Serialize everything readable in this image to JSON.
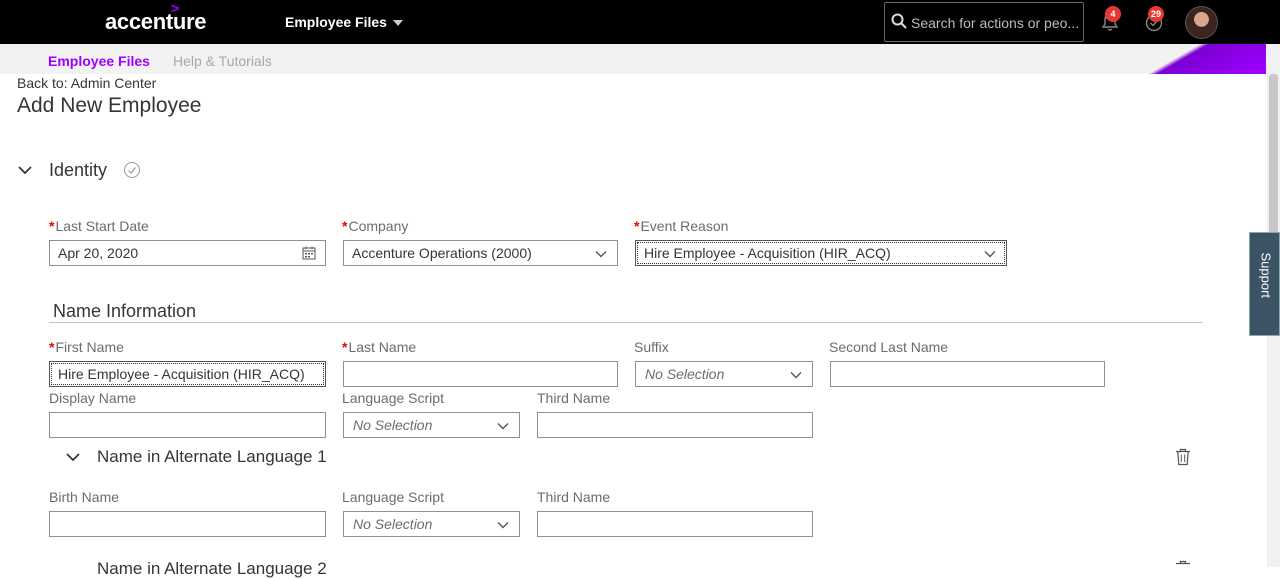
{
  "header": {
    "logo": "accenture",
    "app_menu_label": "Employee Files",
    "search_placeholder": "Search for actions or peo...",
    "notifications_count": "4",
    "approvals_count": "29"
  },
  "subnav": {
    "tabs": [
      {
        "label": "Employee Files"
      },
      {
        "label": "Help & Tutorials"
      }
    ]
  },
  "support_label": "Support",
  "page": {
    "back_link": "Back to: Admin Center",
    "title": "Add New Employee"
  },
  "identity": {
    "title": "Identity",
    "fields": {
      "last_start_date": {
        "label": "Last Start Date",
        "value": "Apr 20, 2020"
      },
      "company": {
        "label": "Company",
        "value": "Accenture Operations (2000)"
      },
      "event_reason": {
        "label": "Event Reason",
        "value": "Hire Employee - Acquisition (HIR_ACQ)"
      }
    }
  },
  "name_info": {
    "title": "Name Information",
    "first_name": {
      "label": "First Name",
      "value": "Hire Employee - Acquisition (HIR_ACQ)"
    },
    "last_name": {
      "label": "Last Name",
      "value": ""
    },
    "suffix": {
      "label": "Suffix",
      "value": "No Selection"
    },
    "second_last_name": {
      "label": "Second Last Name",
      "value": ""
    },
    "display_name": {
      "label": "Display Name",
      "value": ""
    },
    "language_script": {
      "label": "Language Script",
      "value": "No Selection"
    },
    "third_name": {
      "label": "Third Name",
      "value": ""
    }
  },
  "alt_language_1": {
    "title": "Name in Alternate Language 1",
    "birth_name": {
      "label": "Birth Name",
      "value": ""
    },
    "language_script": {
      "label": "Language Script",
      "value": "No Selection"
    },
    "third_name": {
      "label": "Third Name",
      "value": ""
    }
  },
  "alt_language_2": {
    "title": "Name in Alternate Language 2"
  },
  "colors": {
    "accent": "#a100ff",
    "required": "#ee0000",
    "topbar": "#000000",
    "support_tab": "#3c5366"
  }
}
